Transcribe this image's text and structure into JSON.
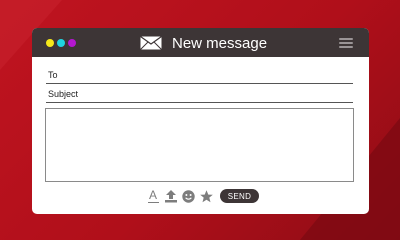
{
  "window": {
    "title": "New message",
    "traffic_lights": [
      "yellow",
      "cyan",
      "magenta"
    ],
    "icons": {
      "title_icon": "envelope-icon",
      "menu": "hamburger-menu-icon"
    }
  },
  "fields": {
    "to_label": "To",
    "to_value": "",
    "subject_label": "Subject",
    "subject_value": "",
    "body_value": ""
  },
  "toolbar": {
    "icons": [
      "text-format-icon",
      "upload-icon",
      "emoji-icon",
      "star-icon"
    ],
    "send_label": "SEND"
  },
  "colors": {
    "background": "#b3101b",
    "titlebar": "#3d3536",
    "window": "#ffffff",
    "dot_yellow": "#f6e81a",
    "dot_cyan": "#20d4e0",
    "dot_magenta": "#b517d1",
    "icon_gray": "#7d7d7d"
  }
}
